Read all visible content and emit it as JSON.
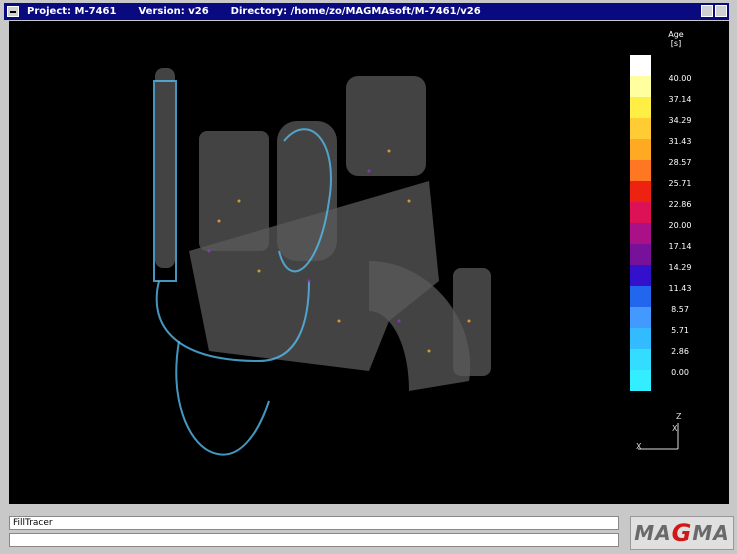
{
  "titlebar": {
    "project": "Project: M-7461",
    "version": "Version: v26",
    "directory": "Directory: /home/zo/MAGMAsoft/M-7461/v26"
  },
  "legend": {
    "title": "Age",
    "unit": "[s]",
    "colors": [
      "#ffffff",
      "#ffff9a",
      "#ffee44",
      "#ffcc33",
      "#ffaa22",
      "#ff7722",
      "#ee2211",
      "#dd1155",
      "#aa1188",
      "#771199",
      "#3311cc",
      "#2266ee",
      "#4499ff",
      "#33ccee",
      "#33eeff",
      "#33ddff"
    ],
    "labels": [
      "40.00",
      "37.14",
      "34.29",
      "31.43",
      "28.57",
      "25.71",
      "22.86",
      "20.00",
      "17.14",
      "14.29",
      "11.43",
      "8.57",
      "5.71",
      "2.86",
      "0.00"
    ]
  },
  "axes": {
    "z": "Z",
    "x_upper": "X",
    "x_lower": "X"
  },
  "status": {
    "text": "FillTracer",
    "secondary": ""
  },
  "logo": {
    "left": "MA",
    "middle": "G",
    "right": "MA"
  }
}
